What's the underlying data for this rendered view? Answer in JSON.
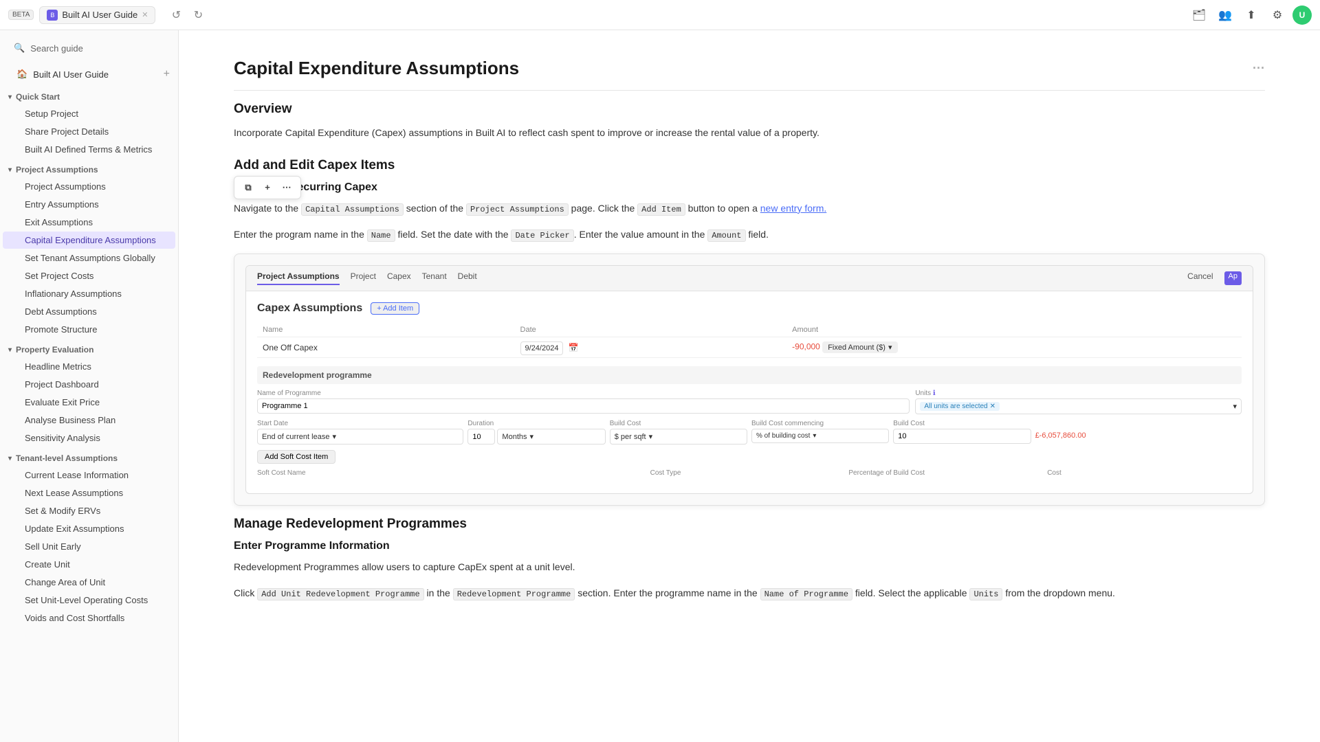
{
  "topbar": {
    "beta_label": "BETA",
    "tab_label": "Built AI User Guide",
    "tab_icon": "B",
    "undo_title": "Undo",
    "redo_title": "Redo",
    "avatar_initials": "U"
  },
  "sidebar": {
    "search_placeholder": "Search guide",
    "home_label": "Built AI User Guide",
    "quick_start": {
      "label": "Quick Start",
      "items": [
        "Setup Project",
        "Share Project Details",
        "Built AI Defined Terms & Metrics"
      ]
    },
    "project_assumptions": {
      "label": "Project Assumptions",
      "items": [
        "Project Assumptions",
        "Entry Assumptions",
        "Exit Assumptions",
        "Capital Expenditure Assumptions",
        "Set Tenant Assumptions Globally",
        "Set Project Costs",
        "Inflationary Assumptions",
        "Debt Assumptions",
        "Promote Structure"
      ]
    },
    "property_evaluation": {
      "label": "Property Evaluation",
      "items": [
        "Headline Metrics",
        "Project Dashboard",
        "Evaluate Exit Price",
        "Analyse Business Plan",
        "Sensitivity Analysis"
      ]
    },
    "tenant_level": {
      "label": "Tenant-level Assumptions",
      "items": [
        "Current Lease Information",
        "Next Lease Assumptions",
        "Set & Modify ERVs",
        "Update Exit Assumptions",
        "Sell Unit Early",
        "Create Unit",
        "Change Area of Unit",
        "Set Unit-Level Operating Costs",
        "Voids and Cost Shortfalls"
      ]
    }
  },
  "page": {
    "title": "Capital Expenditure Assumptions",
    "menu_dots": "···",
    "overview": {
      "heading": "Overview",
      "text": "Incorporate Capital Expenditure (Capex) assumptions in Built AI to reflect cash spent to improve or increase the rental value of a property."
    },
    "add_edit": {
      "heading": "Add and Edit Capex Items",
      "one_off_heading": "One off or Recurring Capex",
      "para1_prefix": "Navigate to the",
      "para1_code1": "Capital Assumptions",
      "para1_mid": "section of the",
      "para1_code2": "Project Assumptions",
      "para1_mid2": "page. Click the",
      "para1_code3": "Add Item",
      "para1_suffix": "button to open a",
      "para1_link": "new entry form.",
      "para2_prefix": "Enter the program name in the",
      "para2_code1": "Name",
      "para2_mid": "field. Set the date with the",
      "para2_code2": "Date Picker",
      "para2_mid2": ". Enter the value amount in the",
      "para2_code3": "Amount",
      "para2_suffix": "field."
    },
    "screenshot": {
      "nav_items": [
        "Project Assumptions",
        "Project",
        "Capex",
        "Tenant",
        "Debit"
      ],
      "nav_active": "Project Assumptions",
      "cancel_btn": "Cancel",
      "apply_btn": "Ap",
      "capex_title": "Capex Assumptions",
      "add_item_btn": "+ Add Item",
      "table_headers": [
        "Name",
        "Date",
        "Amount"
      ],
      "table_row": {
        "name": "One Off Capex",
        "date": "9/24/2024",
        "amount": "-90,000",
        "badge": "Fixed Amount ($)"
      },
      "redevelopment_label": "Redevelopment programme",
      "programme_headers": [
        "Name of Programme",
        "Units"
      ],
      "programme_row_name": "Programme 1",
      "all_units_label": "All units are selected",
      "programme_sub_headers": [
        "Start Date",
        "Duration",
        "Build Cost",
        "Build Cost commencing",
        "Build Cost"
      ],
      "start_date": "End of current lease",
      "duration": "10",
      "duration_unit": "Months",
      "build_cost_type": "$ per sqft",
      "build_cost_pct": "% of building cost",
      "build_cost_val": "£-6,057,860.00",
      "build_cost_num": "10",
      "soft_cost_btn": "Add Soft Cost Item",
      "soft_cost_headers": [
        "Soft Cost Name",
        "Cost Type",
        "Percentage of Build Cost",
        "Cost"
      ]
    },
    "manage": {
      "heading": "Manage Redevelopment Programmes",
      "enter_heading": "Enter Programme Information",
      "para": "Redevelopment Programmes allow users to capture CapEx spent at a unit level.",
      "para2_prefix": "Click",
      "para2_code1": "Add Unit Redevelopment Programme",
      "para2_mid": "in the",
      "para2_code2": "Redevelopment Programme",
      "para2_mid2": "section. Enter the programme name in the",
      "para2_code3": "Name of Programme",
      "para2_mid3": "field. Select the applicable",
      "para2_code4": "Units",
      "para2_suffix": "from the dropdown menu."
    }
  }
}
